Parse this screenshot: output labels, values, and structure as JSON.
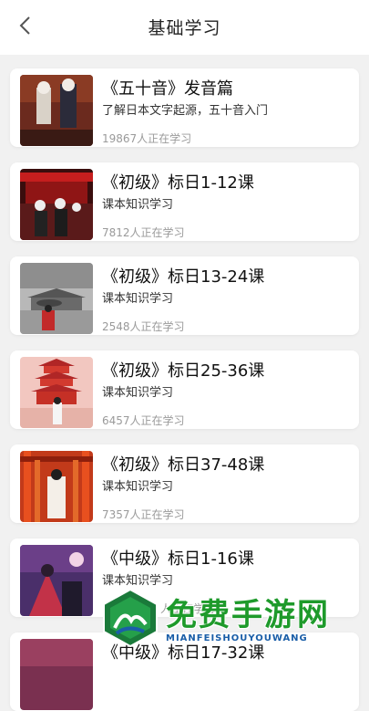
{
  "header": {
    "title": "基础学习",
    "back_icon": "chevron-left-icon"
  },
  "courses": [
    {
      "title": "《五十音》发音篇",
      "subtitle": "了解日本文字起源，五十音入门",
      "learners": "19867人正在学习"
    },
    {
      "title": "《初级》标日1-12课",
      "subtitle": "课本知识学习",
      "learners": "7812人正在学习"
    },
    {
      "title": "《初级》标日13-24课",
      "subtitle": "课本知识学习",
      "learners": "2548人正在学习"
    },
    {
      "title": "《初级》标日25-36课",
      "subtitle": "课本知识学习",
      "learners": "6457人正在学习"
    },
    {
      "title": "《初级》标日37-48课",
      "subtitle": "课本知识学习",
      "learners": "7357人正在学习"
    },
    {
      "title": "《中级》标日1-16课",
      "subtitle": "课本知识学习",
      "learners": "人正在学习"
    },
    {
      "title": "《中级》标日17-32课",
      "subtitle": "",
      "learners": ""
    }
  ],
  "watermark": {
    "text": "免费手游网",
    "sub": "MIANFEISHOUYOUWANG"
  }
}
